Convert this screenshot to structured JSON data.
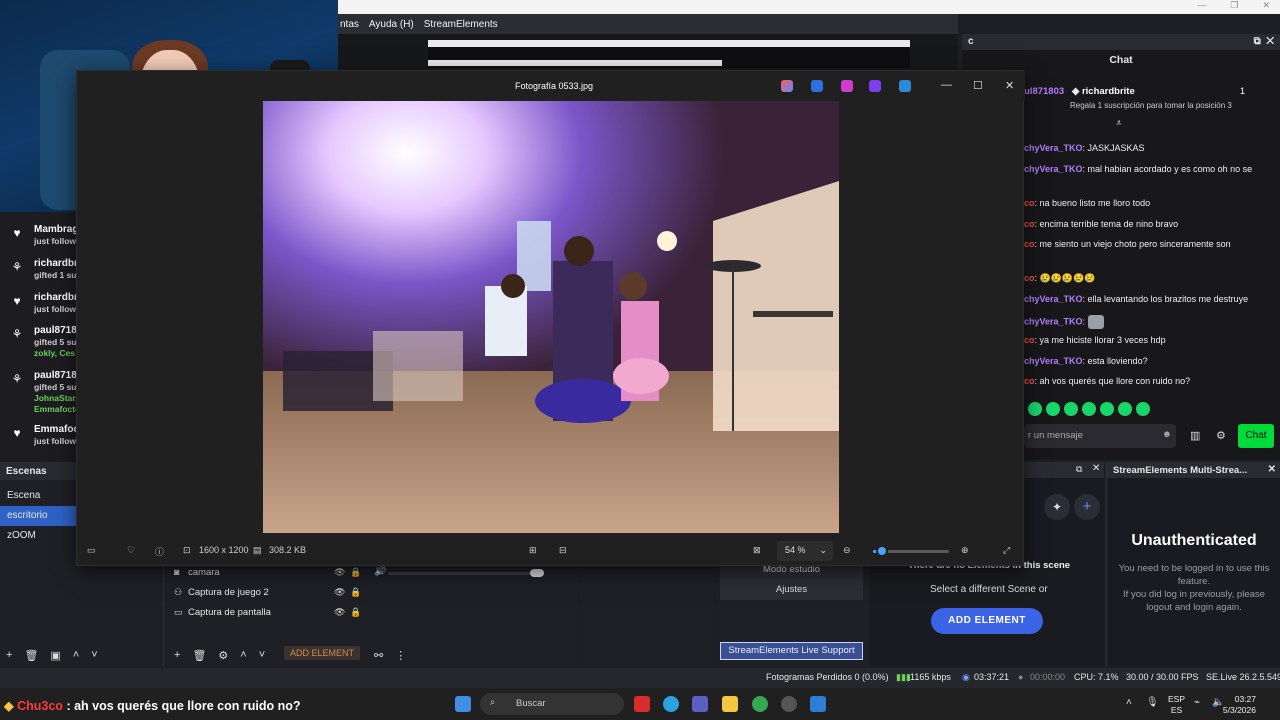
{
  "menubar": {
    "items": [
      "ntas",
      "Ayuda (H)",
      "StreamElements"
    ]
  },
  "activity_feed": [
    {
      "icon": "heart-icon",
      "name": "Mambrag",
      "line1": "just follow"
    },
    {
      "icon": "gift-icon",
      "name": "richardbr",
      "line1": "gifted 1 sul"
    },
    {
      "icon": "heart-icon",
      "name": "richardbr",
      "line1": "just follow"
    },
    {
      "icon": "gift-icon",
      "name": "paul8718",
      "line1": "gifted 5 su",
      "line2": "zokly, Ces"
    },
    {
      "icon": "gift-icon",
      "name": "paul8718",
      "line1": "gifted 5 su",
      "line2": "JohnaStar,",
      "line3": "Emmafocte"
    },
    {
      "icon": "heart-icon",
      "name": "Emmafoc",
      "line1": "just follow"
    }
  ],
  "scenes": {
    "title": "Escenas",
    "items": [
      "Escena",
      "escritorio",
      "zOOM"
    ],
    "selected": "escritorio"
  },
  "sources": {
    "items": [
      "camara",
      "Captura de juego 2",
      "Captura de pantalla"
    ],
    "add_element": "ADD ELEMENT"
  },
  "controls": {
    "studio_mode": "Modo estudio",
    "settings": "Ajustes",
    "live_support": "StreamElements Live Support"
  },
  "se_panel": {
    "no_elements": "There are no Elements in this scene",
    "select_different": "Select a different Scene or",
    "add_element": "ADD ELEMENT"
  },
  "multistream": {
    "title": "StreamElements Multi-Strea...",
    "heading": "Unauthenticated",
    "msg1": "You need to be logged in to use this feature.",
    "msg2": "If you did log in previously, please logout and login again."
  },
  "chat": {
    "tab": "c",
    "title": "Chat",
    "pinned_user_prefix": "ul871803",
    "pinned_user": "richardbrite",
    "pinned_count": "1",
    "pinned_text": "Regala 1 suscripción para tomar la posición 3",
    "messages": [
      {
        "user": "chyVera_TKO",
        "text": ": JASKJASKAS",
        "color": "ucol1"
      },
      {
        "user": "chyVera_TKO",
        "text": ": mal habian acordado y es como oh no se",
        "color": "ucol1"
      },
      {
        "user": "co",
        "text": ": na bueno listo me lloro todo",
        "color": "ucol2"
      },
      {
        "user": "co",
        "text": ": encima terrible tema de nino bravo",
        "color": "ucol2"
      },
      {
        "user": "co",
        "text": ": me siento un viejo choto pero sinceramente son",
        "color": "ucol2"
      },
      {
        "user": "co",
        "text": ": 😢😢😢😢😢",
        "color": "ucol2"
      },
      {
        "user": "chyVera_TKO",
        "text": ": ella levantando los brazitos me destruye",
        "color": "ucol1"
      },
      {
        "user": "chyVera_TKO",
        "text": ":",
        "color": "ucol1"
      },
      {
        "user": "co",
        "text": ": ya me hiciste llorar 3 veces hdp",
        "color": "ucol2"
      },
      {
        "user": "chyVera_TKO",
        "text": ": esta lloviendo?",
        "color": "ucol1"
      },
      {
        "user": "co",
        "text": ": ah vos querés que llore con ruido no?",
        "color": "ucol2"
      }
    ],
    "input_placeholder": "r un mensaje",
    "send": "Chat"
  },
  "viewer": {
    "title": "Fotografía 0533.jpg",
    "dimensions": "1600 x 1200",
    "size": "308.2 KB",
    "zoom": "54 %",
    "zoom_level": 0.12
  },
  "status": {
    "dropped": "Fotogramas Perdidos 0 (0.0%)",
    "kbps": "1165 kbps",
    "live_time": "03:37:21",
    "rec_time": "00:00:00",
    "cpu": "CPU: 7.1%",
    "fps": "30.00 / 30.00 FPS",
    "version": "SE.Live 26.2.5.549"
  },
  "taskbar": {
    "alert_name": "Chu3co",
    "alert_text": ": ah vos querés que llore con ruido no?",
    "search": "Buscar",
    "lang1": "ESP",
    "lang2": "ES",
    "time": "03:27",
    "date": "5/3/2026"
  }
}
